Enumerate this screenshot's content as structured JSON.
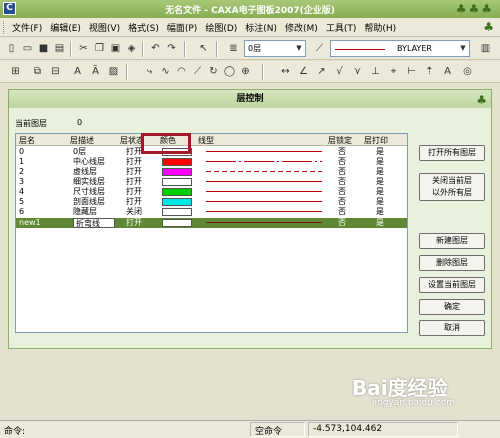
{
  "window": {
    "title": "无名文件 - CAXA电子图板2007(企业版)"
  },
  "menu": [
    "文件(F)",
    "编辑(E)",
    "视图(V)",
    "格式(S)",
    "幅面(P)",
    "绘图(D)",
    "标注(N)",
    "修改(M)",
    "工具(T)",
    "帮助(H)"
  ],
  "toolbar": {
    "layer_combo": "0层",
    "linetype_combo": "BYLAYER"
  },
  "dialog": {
    "title": "层控制",
    "current_layer_label": "当前图层",
    "current_layer_value": "0",
    "columns": [
      "层名",
      "层描述",
      "层状态",
      "颜色",
      "线型",
      "层锁定",
      "层打印"
    ],
    "rows": [
      {
        "name": "0",
        "desc": "0层",
        "state": "打开",
        "color": "#ffffff",
        "linetype": "solid",
        "lock": "否",
        "print": "是"
      },
      {
        "name": "1",
        "desc": "中心线层",
        "state": "打开",
        "color": "#ff0000",
        "linetype": "center",
        "lock": "否",
        "print": "是"
      },
      {
        "name": "2",
        "desc": "虚线层",
        "state": "打开",
        "color": "#ff00ff",
        "linetype": "dashed",
        "lock": "否",
        "print": "是"
      },
      {
        "name": "3",
        "desc": "细实线层",
        "state": "打开",
        "color": "#ffffff",
        "linetype": "solid",
        "lock": "否",
        "print": "是"
      },
      {
        "name": "4",
        "desc": "尺寸线层",
        "state": "打开",
        "color": "#00cc00",
        "linetype": "solid",
        "lock": "否",
        "print": "是"
      },
      {
        "name": "5",
        "desc": "剖面线层",
        "state": "打开",
        "color": "#00e5e5",
        "linetype": "solid",
        "lock": "否",
        "print": "是"
      },
      {
        "name": "6",
        "desc": "隐藏层",
        "state": "关闭",
        "color": "#ffffff",
        "linetype": "solid",
        "lock": "否",
        "print": "是"
      },
      {
        "name": "new1",
        "desc": "折弯线",
        "state": "打开",
        "color": "#ffffff",
        "linetype": "solid",
        "lock": "否",
        "print": "是",
        "selected": true
      }
    ],
    "buttons": {
      "open_all": "打开所有图层",
      "close_others_1": "关闭当前层",
      "close_others_2": "以外所有层",
      "new_layer": "新建图层",
      "delete_layer": "删除图层",
      "set_current": "设置当前图层",
      "ok": "确定",
      "cancel": "取消"
    }
  },
  "status": {
    "command": "命令:",
    "empty_command": "空命令",
    "coords": "-4.573,104.462"
  },
  "watermark": {
    "main": "Bai度经验",
    "sub": "jingyan.baidu.com"
  }
}
